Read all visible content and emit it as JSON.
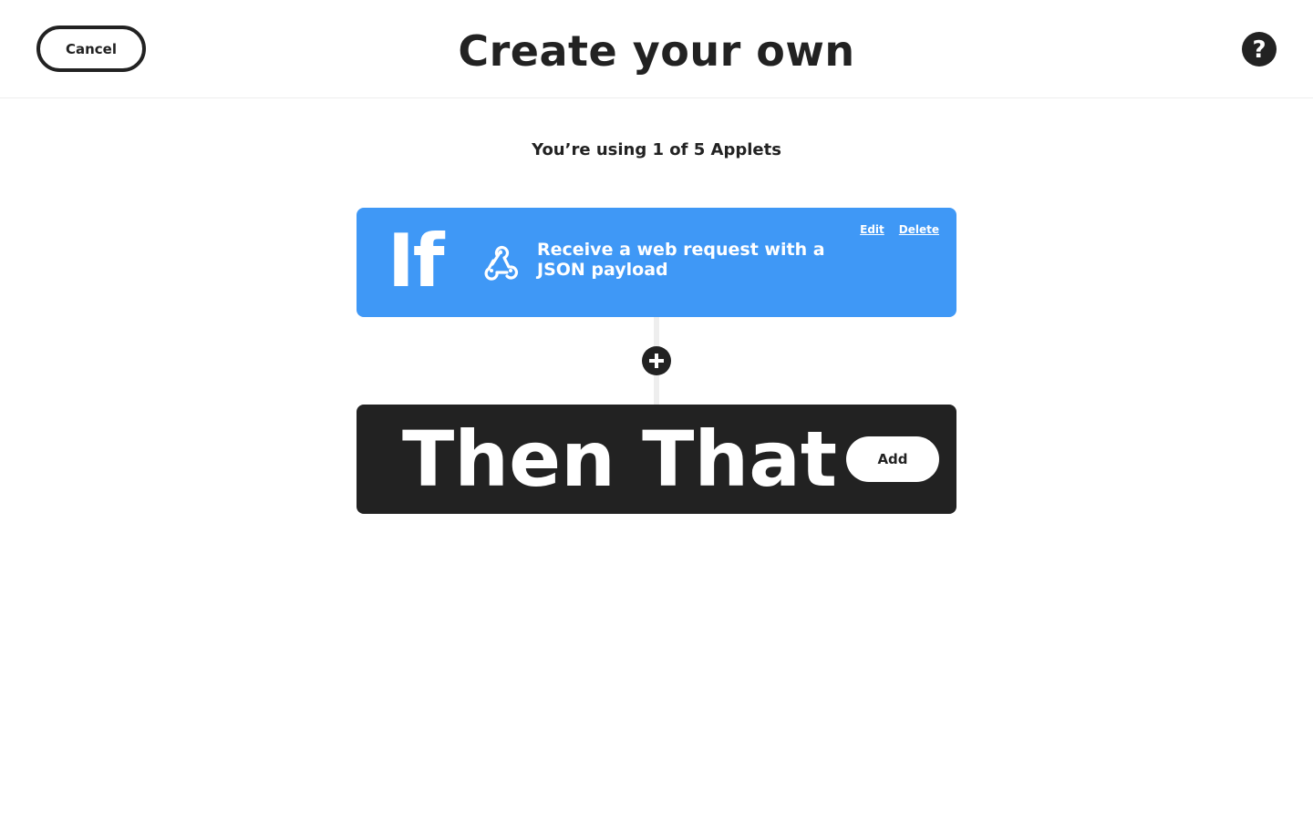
{
  "header": {
    "cancel_label": "Cancel",
    "title": "Create your own",
    "help_icon": "question-circle-icon"
  },
  "usage": {
    "text": "You’re using 1 of 5 Applets"
  },
  "if_card": {
    "keyword": "If",
    "service_icon": "webhook-icon",
    "trigger_text": "Receive a web request with a JSON payload",
    "edit_label": "Edit",
    "delete_label": "Delete",
    "color": "#3f98f6"
  },
  "connector": {
    "add_icon": "plus-circle-icon"
  },
  "then_card": {
    "keyword": "Then That",
    "add_label": "Add",
    "color": "#222222"
  }
}
